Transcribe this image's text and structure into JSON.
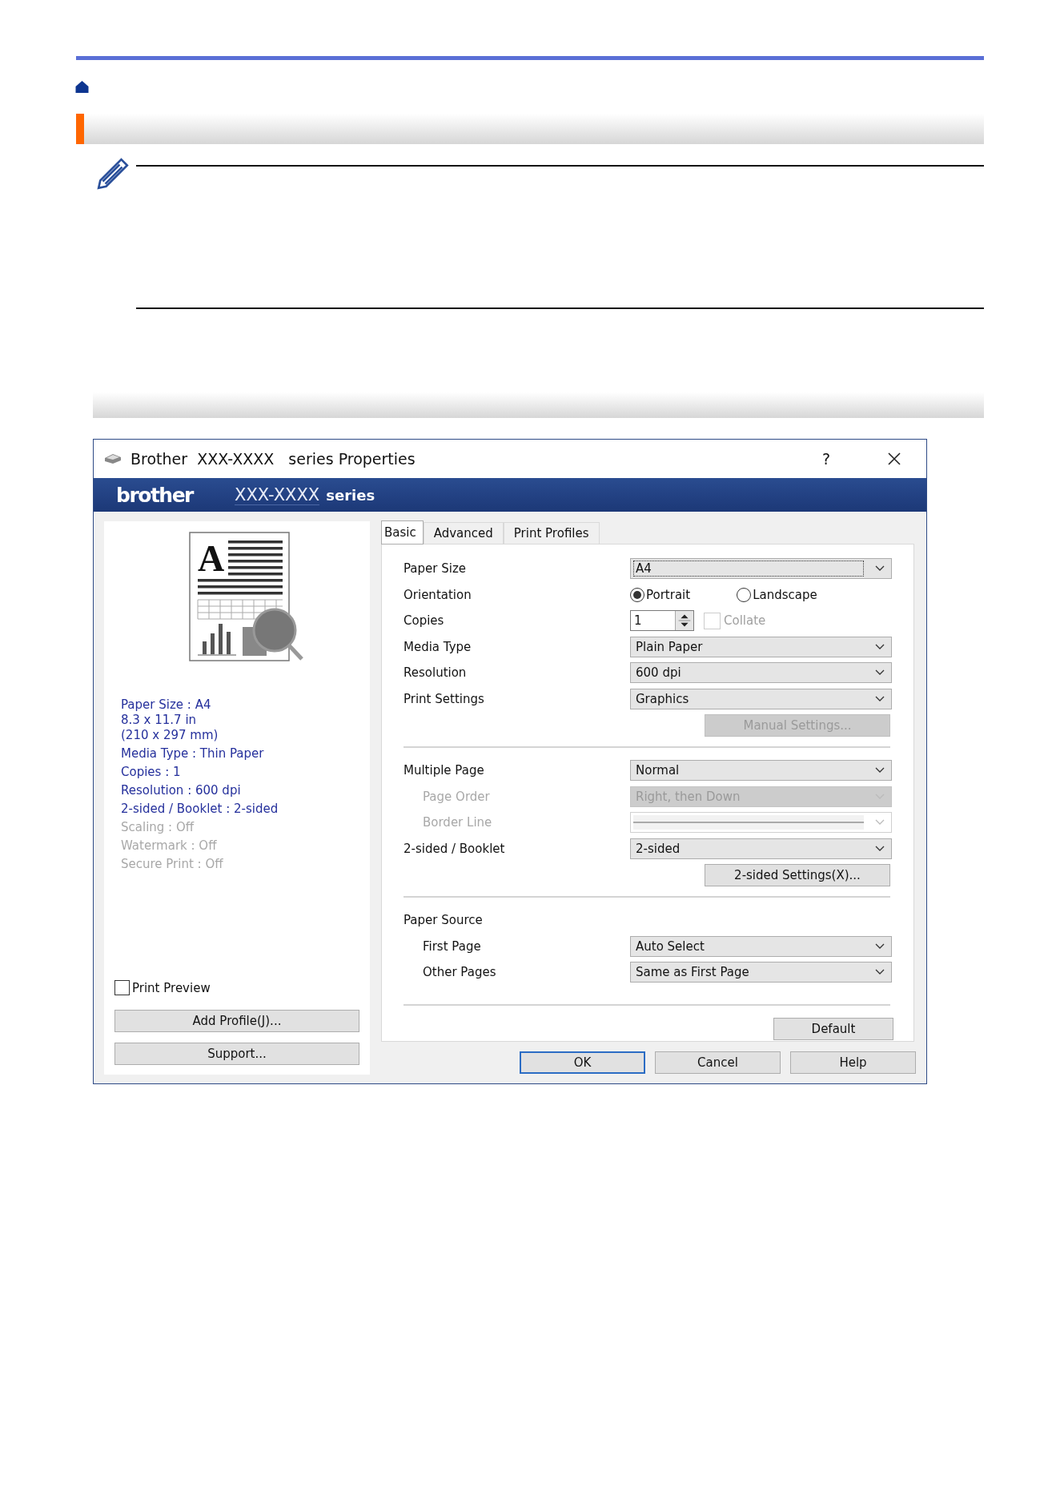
{
  "dialog": {
    "title": "Brother  XXX-XXXX   series Properties",
    "help": "?",
    "banner": {
      "logo": "brother",
      "model": "XXX-XXXX",
      "series": "series"
    },
    "summary": [
      {
        "lines": [
          "Paper Size : A4",
          "8.3 x 11.7 in",
          "(210 x 297 mm)"
        ],
        "disabled": false
      },
      {
        "lines": [
          "Media Type : Thin Paper"
        ],
        "disabled": false
      },
      {
        "lines": [
          "Copies : 1"
        ],
        "disabled": false
      },
      {
        "lines": [
          "Resolution : 600 dpi"
        ],
        "disabled": false
      },
      {
        "lines": [
          "2-sided / Booklet : 2-sided"
        ],
        "disabled": false
      },
      {
        "lines": [
          "Scaling : Off"
        ],
        "disabled": true
      },
      {
        "lines": [
          "Watermark : Off"
        ],
        "disabled": true
      },
      {
        "lines": [
          "Secure Print : Off"
        ],
        "disabled": true
      }
    ],
    "preview_glyph": "A",
    "print_preview": {
      "label": "Print Preview",
      "checked": false
    },
    "side_buttons": [
      "Add Profile(J)...",
      "Support..."
    ],
    "tabs": [
      {
        "label": "Basic",
        "selected": true
      },
      {
        "label": "Advanced",
        "selected": false
      },
      {
        "label": "Print Profiles",
        "selected": false
      }
    ],
    "rows": [
      {
        "kind": "select",
        "label": "Paper Size",
        "value": "A4",
        "focused": true,
        "disabled": false,
        "indented": false
      },
      {
        "kind": "radio",
        "label": "Orientation",
        "options": [
          {
            "label": "Portrait",
            "selected": true
          },
          {
            "label": "Landscape",
            "selected": false
          }
        ]
      },
      {
        "kind": "spin",
        "label": "Copies",
        "value": "1",
        "collate": {
          "label": "Collate",
          "checked": false,
          "disabled": true
        }
      },
      {
        "kind": "select",
        "label": "Media Type",
        "value": "Plain Paper",
        "focused": false,
        "disabled": false,
        "indented": false
      },
      {
        "kind": "select",
        "label": "Resolution",
        "value": "600 dpi",
        "focused": false,
        "disabled": false,
        "indented": false
      },
      {
        "kind": "select",
        "label": "Print Settings",
        "value": "Graphics",
        "focused": false,
        "disabled": false,
        "indented": false
      },
      {
        "kind": "button",
        "label": "Manual Settings...",
        "disabled": true
      },
      {
        "kind": "separator"
      },
      {
        "kind": "select",
        "label": "Multiple Page",
        "value": "Normal",
        "focused": false,
        "disabled": false,
        "indented": false
      },
      {
        "kind": "select",
        "label": "Page Order",
        "value": "Right, then Down",
        "focused": false,
        "disabled": true,
        "indented": true
      },
      {
        "kind": "line_select",
        "label": "Border Line",
        "disabled": true,
        "indented": true
      },
      {
        "kind": "select",
        "label": "2-sided / Booklet",
        "value": "2-sided",
        "focused": false,
        "disabled": false,
        "indented": false
      },
      {
        "kind": "button",
        "label": "2-sided Settings(X)...",
        "disabled": false
      },
      {
        "kind": "separator"
      },
      {
        "kind": "heading",
        "label": "Paper Source"
      },
      {
        "kind": "select",
        "label": "First Page",
        "value": "Auto Select",
        "focused": false,
        "disabled": false,
        "indented": true
      },
      {
        "kind": "select",
        "label": "Other Pages",
        "value": "Same as First Page",
        "focused": false,
        "disabled": false,
        "indented": true
      },
      {
        "kind": "spacer"
      },
      {
        "kind": "separator"
      },
      {
        "kind": "small_button",
        "label": "Default",
        "disabled": false
      }
    ],
    "footer_buttons": [
      {
        "label": "OK",
        "focused": true
      },
      {
        "label": "Cancel",
        "focused": false
      },
      {
        "label": "Help",
        "focused": false
      }
    ]
  }
}
